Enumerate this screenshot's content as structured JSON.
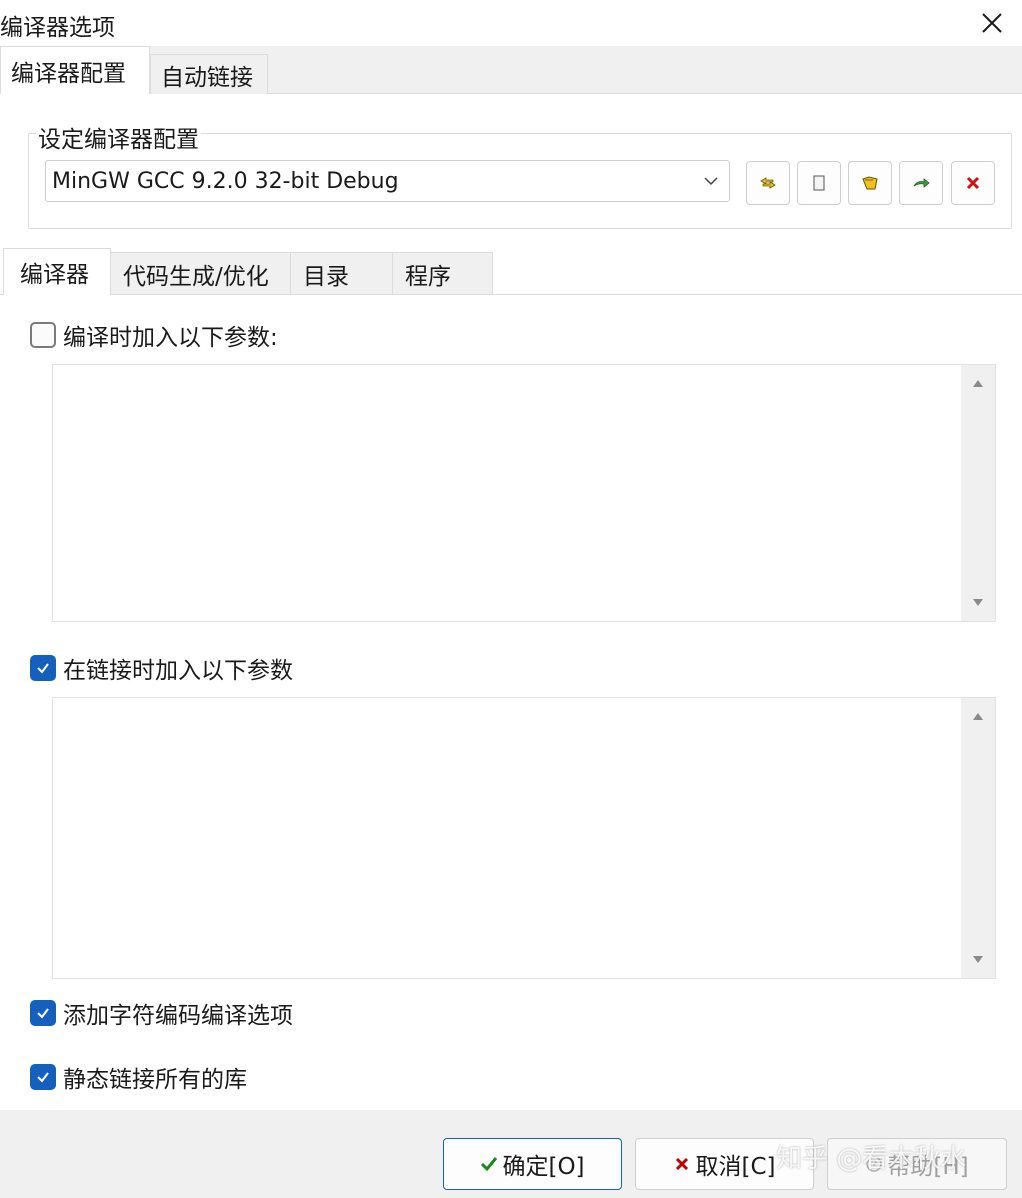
{
  "window": {
    "title": "编译器选项"
  },
  "outer_tabs": [
    {
      "label": "编译器配置",
      "active": true
    },
    {
      "label": "自动链接",
      "active": false
    }
  ],
  "group": {
    "label": "设定编译器配置",
    "combo_value": "MinGW GCC 9.2.0 32-bit Debug"
  },
  "toolbar_icons": [
    "rename-icon",
    "new-icon",
    "folder-icon",
    "export-icon",
    "delete-icon"
  ],
  "inner_tabs": [
    {
      "label": "编译器",
      "active": true
    },
    {
      "label": "代码生成/优化",
      "active": false
    },
    {
      "label": "目录",
      "active": false
    },
    {
      "label": "程序",
      "active": false
    }
  ],
  "compile_params": {
    "label": "编译时加入以下参数:",
    "checked": false,
    "value": ""
  },
  "link_params": {
    "label": "在链接时加入以下参数",
    "checked": true,
    "value": ""
  },
  "charset_option": {
    "label": "添加字符编码编译选项",
    "checked": true
  },
  "static_link_option": {
    "label": "静态链接所有的库",
    "checked": true
  },
  "buttons": {
    "ok": "确定[O]",
    "cancel": "取消[C]",
    "help": "帮助[H]"
  },
  "watermark": "知乎 @看木秋水",
  "colors": {
    "accent": "#1560bd",
    "ok_check": "#1a8a1a",
    "cancel_x": "#c00000"
  }
}
